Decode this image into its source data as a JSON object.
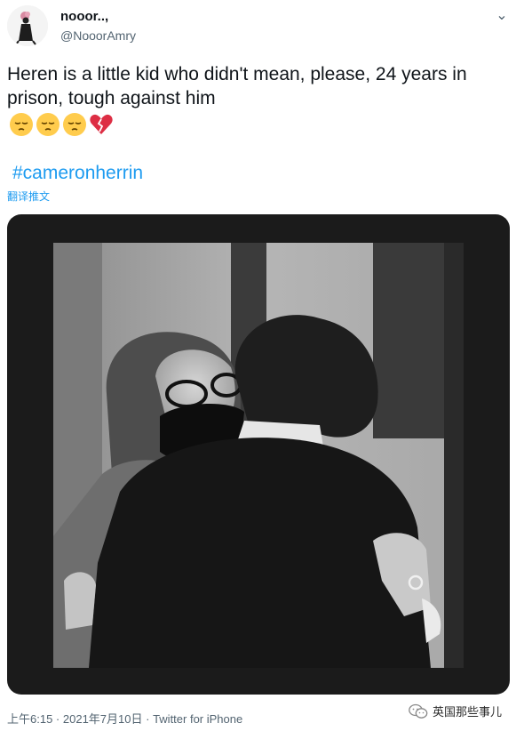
{
  "user": {
    "display_name": "nooor..,",
    "handle": "@NooorAmry"
  },
  "menu": {
    "more_icon": "chevron-down-icon",
    "more_glyph": "⌄"
  },
  "tweet": {
    "text": "Heren is a little kid who didn't mean, please, 24 years in prison, tough against him",
    "emojis": [
      "pensive-face",
      "pensive-face",
      "pensive-face",
      "broken-heart"
    ],
    "hashtag": "#cameronherrin",
    "translate_label": "翻译推文"
  },
  "footer": {
    "time": "上午6:15",
    "separator1": " · ",
    "date": "2021年7月10日",
    "separator2": " · ",
    "source": "Twitter for iPhone"
  },
  "watermark": {
    "icon": "wechat-icon",
    "text": "英国那些事儿"
  },
  "colors": {
    "link": "#1d9bf0",
    "text": "#0f1419",
    "muted": "#536471",
    "media_frame": "#1b1b1b"
  }
}
